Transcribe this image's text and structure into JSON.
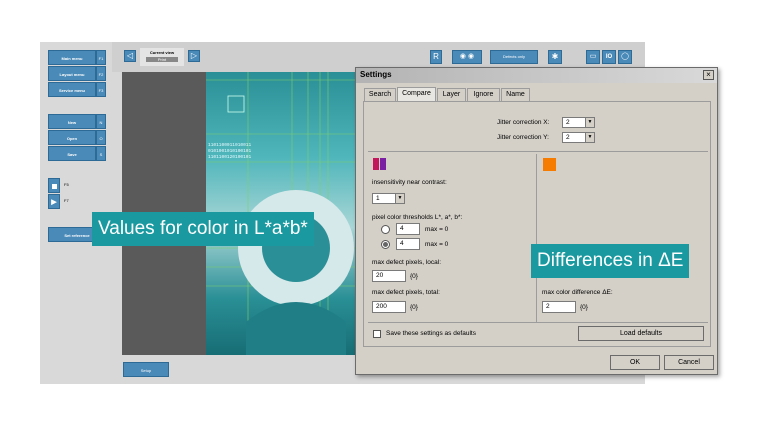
{
  "left_menu": {
    "items": [
      {
        "label": "Main menu",
        "key": "F1"
      },
      {
        "label": "Layout menu",
        "key": "F2"
      },
      {
        "label": "Service menu",
        "key": "F3"
      }
    ],
    "file_items": [
      {
        "label": "New",
        "key": "N"
      },
      {
        "label": "Open",
        "key": "O"
      },
      {
        "label": "Save",
        "key": "S"
      }
    ],
    "f_keys": [
      "F5",
      "F7"
    ],
    "set_reference": "Set reference",
    "setup": "Setup"
  },
  "toolbar": {
    "current_view_label": "Current view",
    "current_view_value": "Print",
    "r_button": "R",
    "defects_only": "Defects only",
    "io_label": "IO"
  },
  "dialog": {
    "title": "Settings",
    "close": "×",
    "tabs": [
      "Search",
      "Compare",
      "Layer",
      "Ignore",
      "Name"
    ],
    "active_tab": "Compare",
    "jitter_x_label": "Jitter correction X:",
    "jitter_x_value": "2",
    "jitter_y_label": "Jitter correction Y:",
    "jitter_y_value": "2",
    "insensitivity_label": "insensitivity near contrast:",
    "insensitivity_value": "1",
    "thresholds_label": "pixel color thresholds L*, a*, b*:",
    "threshold_1_value": "4",
    "threshold_1_max": "max = 0",
    "threshold_2_value": "4",
    "threshold_2_max": "max = 0",
    "max_defect_local_label": "max defect pixels, local:",
    "max_defect_local_value": "20",
    "max_defect_local_unit": "{0}",
    "max_defect_total_label": "max defect pixels, total:",
    "max_defect_total_value": "200",
    "max_defect_total_unit": "{0}",
    "max_color_diff_label": "max color difference ΔE:",
    "max_color_diff_value": "2",
    "max_color_diff_unit": "{0}",
    "save_defaults_label": "Save these settings as defaults",
    "load_defaults": "Load defaults",
    "ok": "OK",
    "cancel": "Cancel"
  },
  "callouts": {
    "lab": "Values for color in L*a*b*",
    "delta_e": "Differences in ΔE"
  },
  "colors": {
    "accent_teal": "#1a9aa0",
    "menu_blue": "#4a8ab8",
    "swatch_magenta": "#c2185b",
    "swatch_purple": "#7b1fa2",
    "swatch_orange": "#f57c00"
  }
}
